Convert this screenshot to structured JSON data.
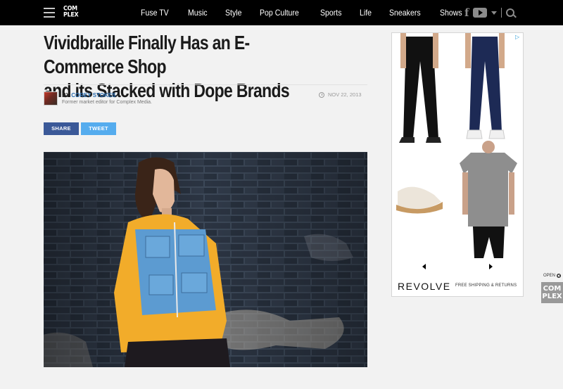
{
  "header": {
    "logo_line1": "COM",
    "logo_line2": "PLEX",
    "nav": [
      "Fuse TV",
      "Music",
      "Style",
      "Pop Culture",
      "Sports",
      "Life",
      "Sneakers",
      "Shows"
    ]
  },
  "article": {
    "title_line1": "Vividbraille Finally Has an E-Commerce Shop",
    "title_line2": "and its Stacked with Dope Brands",
    "byline_prefix": "BY",
    "author": "COREY STOKES",
    "author_bio": "Former market editor for Complex Media.",
    "date": "NOV 22, 2013",
    "share_label": "SHARE",
    "tweet_label": "TWEET"
  },
  "ad": {
    "brand": "REVOLVE",
    "tagline": "FREE SHIPPING & RETURNS"
  },
  "widget": {
    "open_label": "OPEN",
    "logo_line1": "COM",
    "logo_line2": "PLEX"
  },
  "colors": {
    "facebook": "#3b5998",
    "twitter": "#55acee",
    "author_link": "#2a6db0"
  },
  "icons": [
    "menu-icon",
    "facebook-icon",
    "youtube-icon",
    "dropdown-caret-icon",
    "search-icon",
    "clock-icon",
    "ad-choices-icon",
    "arrow-left-icon",
    "arrow-right-icon"
  ]
}
